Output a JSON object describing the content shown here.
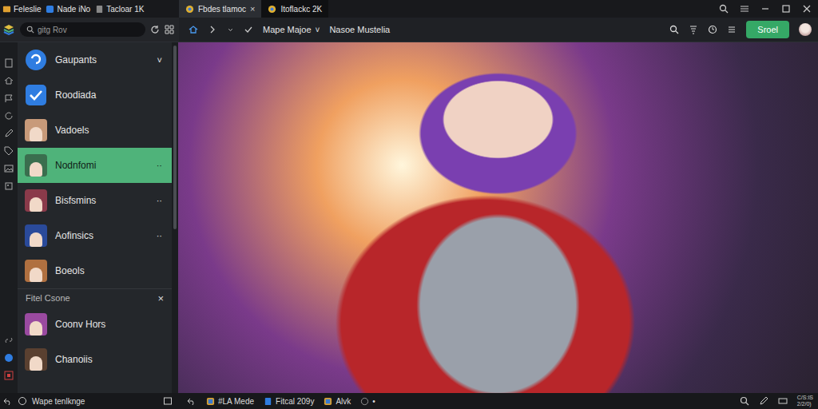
{
  "title_bar": {
    "app_tabs": [
      {
        "label": "Feleslie",
        "kind": "folder"
      },
      {
        "label": "Nade iNo",
        "kind": "app"
      },
      {
        "label": "Tacloar 1K",
        "kind": "doc"
      }
    ],
    "doc_tabs": [
      {
        "label": "Fbdes tlamoc",
        "close": "×",
        "selected": false
      },
      {
        "label": "Itoflackc 2K",
        "selected": true
      }
    ]
  },
  "toolbar": {
    "search": {
      "placeholder": "gitg Rov"
    },
    "menus": [
      {
        "label": "Mape Majoe",
        "caret": "˅"
      },
      {
        "label": "Nasoe Mustelia"
      }
    ],
    "button": "Sroel"
  },
  "sidebar": {
    "items": [
      {
        "label": "Gaupants",
        "kind": "logo",
        "trail": "˅",
        "selected": false
      },
      {
        "label": "Roodiada",
        "kind": "check",
        "selected": false
      },
      {
        "label": "Vadoels",
        "kind": "avatar",
        "color": "#c89a7a",
        "selected": false
      },
      {
        "label": "Nodnfomi",
        "kind": "avatar",
        "color": "#3a6e4e",
        "trail": "··",
        "selected": true
      },
      {
        "label": "Bisfsmins",
        "kind": "avatar",
        "color": "#8a3a4a",
        "trail": "··",
        "selected": false
      },
      {
        "label": "Aofinsics",
        "kind": "avatar",
        "color": "#2a4a9a",
        "trail": "··",
        "selected": false
      },
      {
        "label": "Boeols",
        "kind": "avatar",
        "color": "#b07040",
        "selected": false
      }
    ],
    "section": {
      "label": "Fitel Csone",
      "close": "×"
    },
    "section_items": [
      {
        "label": "Coonv Hors",
        "kind": "avatar",
        "color": "#9a4aa0",
        "selected": false
      },
      {
        "label": "Chanoiis",
        "kind": "avatar",
        "color": "#5a4030",
        "selected": false
      }
    ]
  },
  "status_bar": {
    "left": "Wape tenlknge",
    "tasks": [
      {
        "label": "#LA Mede",
        "kind": "app"
      },
      {
        "label": "Fitcal 209y",
        "kind": "doc"
      },
      {
        "label": "Alvk",
        "kind": "app"
      },
      {
        "label": "•",
        "kind": "clock"
      }
    ],
    "clock": [
      "C/S:IS",
      "2/2/0)"
    ]
  }
}
